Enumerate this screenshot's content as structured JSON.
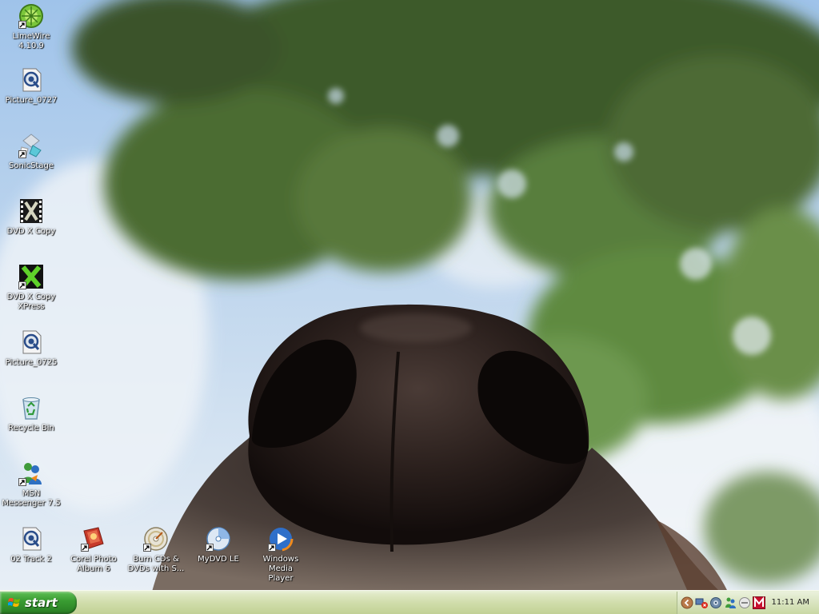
{
  "desktop": {
    "icons": [
      {
        "label": "LimeWire\n4.10.9",
        "icon": "limewire-icon",
        "shortcut": true
      },
      {
        "label": "Picture_0727",
        "icon": "quicktime-file-icon",
        "shortcut": false
      },
      {
        "label": "SonicStage",
        "icon": "sonicstage-icon",
        "shortcut": true
      },
      {
        "label": "DVD X Copy",
        "icon": "dvd-x-copy-icon",
        "shortcut": false
      },
      {
        "label": "DVD X Copy\nXPress",
        "icon": "dvd-x-copy-xpress-icon",
        "shortcut": true
      },
      {
        "label": "Picture_0725",
        "icon": "quicktime-file-icon",
        "shortcut": false
      },
      {
        "label": "Recycle Bin",
        "icon": "recycle-bin-icon",
        "shortcut": false
      },
      {
        "label": "MSN\nMessenger 7.5",
        "icon": "msn-messenger-icon",
        "shortcut": true
      },
      {
        "label": "02 Track 2",
        "icon": "quicktime-file-icon",
        "shortcut": false
      },
      {
        "label": "Corel Photo\nAlbum 6",
        "icon": "corel-photo-album-icon",
        "shortcut": true
      },
      {
        "label": "Burn CDs &\nDVDs with S...",
        "icon": "burn-cd-icon",
        "shortcut": true
      },
      {
        "label": "MyDVD LE",
        "icon": "mydvd-icon",
        "shortcut": true
      },
      {
        "label": "Windows Media\nPlayer",
        "icon": "windows-media-player-icon",
        "shortcut": true
      }
    ]
  },
  "taskbar": {
    "start_label": "start",
    "tray_icons": [
      "tray-expand-icon",
      "network-alert-icon",
      "volume-icon",
      "msn-tray-icon",
      "messenger-tray-icon",
      "mcafee-icon"
    ],
    "clock": "11:11 AM"
  },
  "colors": {
    "taskbar": "#d4deb0",
    "start_button": "#3a9d32",
    "icon_label": "#ffffff"
  }
}
